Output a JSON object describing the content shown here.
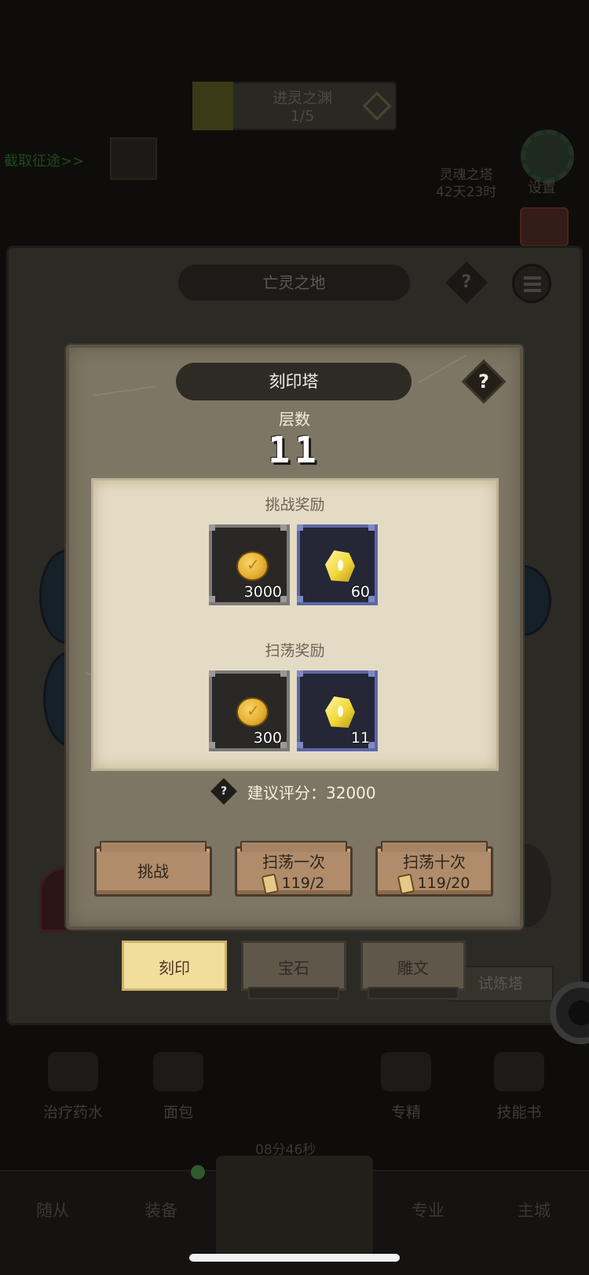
{
  "background": {
    "top_banner": {
      "title": "进灵之渊",
      "progress": "1/5"
    },
    "left_link": "截取征途>>",
    "right_info": {
      "line1": "灵魂之塔",
      "line2": "42天23时"
    },
    "settings_label": "设置",
    "panel_title": "亡灵之地",
    "trial_button": "试炼塔",
    "items": [
      {
        "label": "治疗药水"
      },
      {
        "label": "面包"
      },
      {
        "label": "专精"
      },
      {
        "label": "技能书"
      }
    ],
    "timer": "08分46秒",
    "nav": [
      {
        "label": "随从"
      },
      {
        "label": "装备"
      },
      {
        "label": "专业"
      },
      {
        "label": "主城"
      }
    ]
  },
  "modal": {
    "title": "刻印塔",
    "help_symbol": "?",
    "floor_label": "层数",
    "floor_value": "11",
    "challenge_rewards": {
      "title": "挑战奖励",
      "items": [
        {
          "icon": "gold-coin-icon",
          "quantity": "3000",
          "frame": "gray"
        },
        {
          "icon": "yellow-gem-icon",
          "quantity": "60",
          "frame": "blue"
        }
      ]
    },
    "sweep_rewards": {
      "title": "扫荡奖励",
      "items": [
        {
          "icon": "gold-coin-icon",
          "quantity": "300",
          "frame": "gray"
        },
        {
          "icon": "yellow-gem-icon",
          "quantity": "11",
          "frame": "blue"
        }
      ]
    },
    "recommended_score": {
      "help_symbol": "?",
      "text": "建议评分：32000"
    },
    "buttons": {
      "challenge": "挑战",
      "sweep_once": {
        "label": "扫荡一次",
        "cost": "119/2"
      },
      "sweep_ten": {
        "label": "扫荡十次",
        "cost": "119/20"
      }
    },
    "tabs": [
      {
        "label": "刻印",
        "active": true
      },
      {
        "label": "宝石",
        "active": false
      },
      {
        "label": "雕文",
        "active": false
      }
    ]
  },
  "colors": {
    "modal_bg": "#7d7664",
    "parchment": "#e4dbc4",
    "active_tab": "#f1dd9c",
    "blue_frame": "#5c67a6"
  }
}
